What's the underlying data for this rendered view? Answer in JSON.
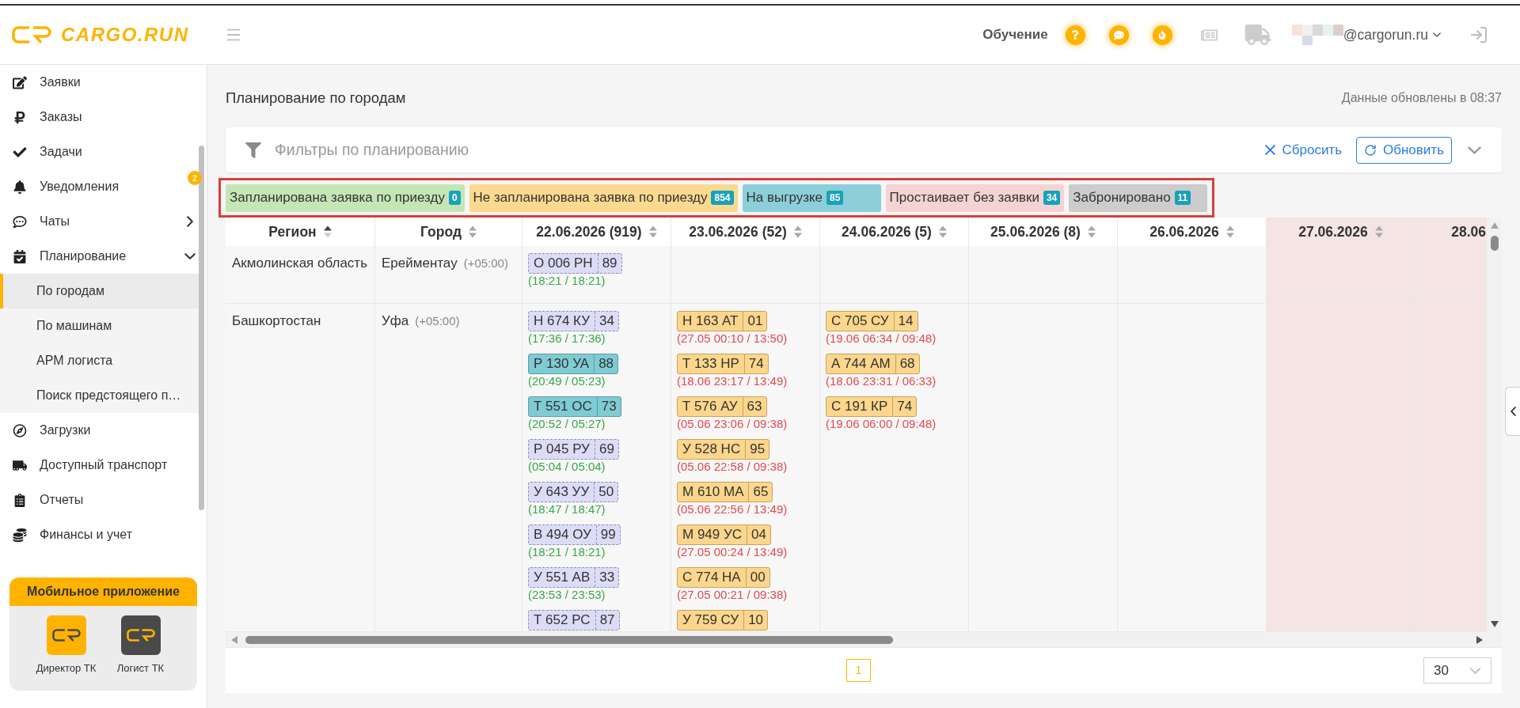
{
  "header": {
    "logo": "CARGO.RUN",
    "training": "Обучение",
    "email": "@cargorun.ru"
  },
  "sidebar": {
    "items": [
      {
        "label": "Заявки"
      },
      {
        "label": "Заказы"
      },
      {
        "label": "Задачи"
      },
      {
        "label": "Уведомления",
        "badge": "2"
      },
      {
        "label": "Чаты",
        "expanded": false
      },
      {
        "label": "Планирование",
        "expanded": true,
        "children": [
          {
            "label": "По городам",
            "selected": true
          },
          {
            "label": "По машинам",
            "selected": false
          },
          {
            "label": "АРМ логиста",
            "selected": false
          },
          {
            "label": "Поиск предстоящего п…",
            "selected": false
          }
        ]
      },
      {
        "label": "Загрузки"
      },
      {
        "label": "Доступный транспорт"
      },
      {
        "label": "Отчеты"
      },
      {
        "label": "Финансы и учет"
      }
    ],
    "mobile_app": {
      "title": "Мобильное приложение",
      "apps": [
        {
          "label": "Директор ТК",
          "color": "#ffb300"
        },
        {
          "label": "Логист ТК",
          "color": "#4a4a4a"
        }
      ]
    }
  },
  "page": {
    "title": "Планирование по городам",
    "updated": "Данные обновлены в 08:37"
  },
  "filters": {
    "title": "Фильтры по планированию",
    "reset": "Сбросить",
    "refresh": "Обновить",
    "expanded": false
  },
  "legend": [
    {
      "label": "Запланирована заявка по приезду",
      "count": "0",
      "color": "#c4e6b4"
    },
    {
      "label": "Не запланирована заявка по приезду",
      "count": "854",
      "color": "#fbd98f"
    },
    {
      "label": "На выгрузке",
      "count": "85",
      "color": "#8ccfd9"
    },
    {
      "label": "Простаивает без заявки",
      "count": "34",
      "color": "#f6d3d3"
    },
    {
      "label": "Забронировано",
      "count": "11",
      "color": "#cccccc"
    }
  ],
  "table": {
    "columns": [
      {
        "label": "Регион",
        "sorted": true
      },
      {
        "label": "Город",
        "sorted": false
      },
      {
        "label": "22.06.2026 (919)",
        "sorted": false,
        "weekend": false
      },
      {
        "label": "23.06.2026 (52)",
        "sorted": false,
        "weekend": false
      },
      {
        "label": "24.06.2026 (5)",
        "sorted": false,
        "weekend": false
      },
      {
        "label": "25.06.2026 (8)",
        "sorted": false,
        "weekend": false
      },
      {
        "label": "26.06.2026",
        "sorted": false,
        "weekend": false
      },
      {
        "label": "27.06.2026",
        "sorted": false,
        "weekend": true
      },
      {
        "label": "28.06",
        "weekend": true
      }
    ],
    "rows": [
      {
        "cells": [
          {
            "text": "Акмолинская область"
          },
          {
            "text": "Ерейментау",
            "timezone": "(+05:00)"
          },
          {
            "vehicles": [
              {
                "plate": "О 006 РН",
                "number": "89",
                "time": "(18:21 / 18:21)",
                "kind": "forecast"
              }
            ]
          },
          "",
          "",
          "",
          "",
          "",
          ""
        ]
      },
      {
        "cells": [
          {
            "text": "Башкортостан"
          },
          {
            "text": "Уфа",
            "timezone": "(+05:00)"
          },
          {
            "vehicles": [
              {
                "plate": "Н 674 КУ",
                "number": "34",
                "time": "(17:36 / 17:36)",
                "kind": "forecast"
              },
              {
                "plate": "Р 130 УА",
                "number": "88",
                "time": "(20:49 / 05:23)",
                "kind": "unloading"
              },
              {
                "plate": "Т 551 ОС",
                "number": "73",
                "time": "(20:52 / 05:27)",
                "kind": "unloading"
              },
              {
                "plate": "Р 045 РУ",
                "number": "69",
                "time": "(05:04 / 05:04)",
                "kind": "forecast"
              },
              {
                "plate": "У 643 УУ",
                "number": "50",
                "time": "(18:47 / 18:47)",
                "kind": "forecast"
              },
              {
                "plate": "В 494 ОУ",
                "number": "99",
                "time": "(18:21 / 18:21)",
                "kind": "forecast"
              },
              {
                "plate": "У 551 АВ",
                "number": "33",
                "time": "(23:53 / 23:53)",
                "kind": "forecast"
              },
              {
                "plate": "Т 652 РС",
                "number": "87",
                "kind": "forecast"
              }
            ]
          },
          {
            "vehicles": [
              {
                "plate": "Н 163 АТ",
                "number": "01",
                "time": "(27.05 00:10 / 13:50)",
                "kind": "unplanned"
              },
              {
                "plate": "Т 133 НР",
                "number": "74",
                "time": "(18.06 23:17 / 13:49)",
                "kind": "unplanned"
              },
              {
                "plate": "Т 576 АУ",
                "number": "63",
                "time": "(05.06 23:06 / 09:38)",
                "kind": "unplanned"
              },
              {
                "plate": "У 528 НС",
                "number": "95",
                "time": "(05.06 22:58 / 09:38)",
                "kind": "unplanned"
              },
              {
                "plate": "М 610 МА",
                "number": "65",
                "time": "(05.06 22:56 / 13:49)",
                "kind": "unplanned"
              },
              {
                "plate": "М 949 УС",
                "number": "04",
                "time": "(27.05 00:24 / 13:49)",
                "kind": "unplanned"
              },
              {
                "plate": "С 774 НА",
                "number": "00",
                "time": "(27.05 00:21 / 09:38)",
                "kind": "unplanned"
              },
              {
                "plate": "У 759 СУ",
                "number": "10",
                "kind": "unplanned"
              }
            ]
          },
          {
            "vehicles": [
              {
                "plate": "С 705 СУ",
                "number": "14",
                "time": "(19.06 06:34 / 09:48)",
                "kind": "unplanned"
              },
              {
                "plate": "А 744 АМ",
                "number": "68",
                "time": "(18.06 23:31 / 06:33)",
                "kind": "unplanned"
              },
              {
                "plate": "С 191 КР",
                "number": "74",
                "time": "(19.06 06:00 / 09:48)",
                "kind": "unplanned"
              }
            ]
          },
          "",
          "",
          "",
          ""
        ]
      }
    ]
  },
  "pagination": {
    "pages": [
      {
        "label": "1",
        "selected": true
      }
    ],
    "page_size": "30"
  }
}
